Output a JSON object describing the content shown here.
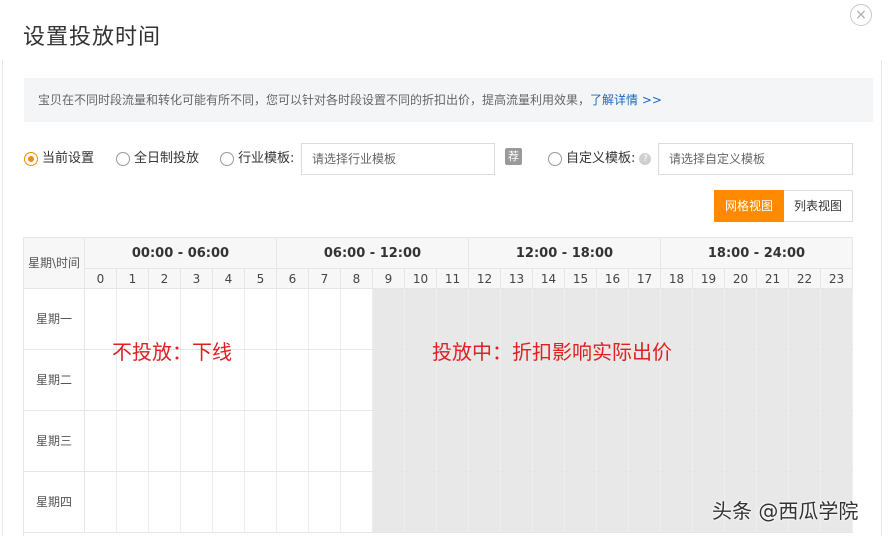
{
  "dialog": {
    "title": "设置投放时间",
    "close_symbol": "×"
  },
  "notice": {
    "text": "宝贝在不同时段流量和转化可能有所不同，您可以针对各时段设置不同的折扣出价，提高流量利用效果，",
    "link": "了解详情 >>"
  },
  "options": {
    "current": "当前设置",
    "all_day": "全日制投放",
    "industry": "行业模板:",
    "industry_placeholder": "请选择行业模板",
    "recommend_badge": "荐",
    "custom": "自定义模板:",
    "custom_placeholder": "请选择自定义模板",
    "selected": "current"
  },
  "view_toggle": {
    "grid": "网格视图",
    "list": "列表视图",
    "active": "grid"
  },
  "grid": {
    "corner": "星期\\时间",
    "ranges": [
      "00:00 - 06:00",
      "06:00 - 12:00",
      "12:00 - 18:00",
      "18:00 - 24:00"
    ],
    "hours": [
      "0",
      "1",
      "2",
      "3",
      "4",
      "5",
      "6",
      "7",
      "8",
      "9",
      "10",
      "11",
      "12",
      "13",
      "14",
      "15",
      "16",
      "17",
      "18",
      "19",
      "20",
      "21",
      "22",
      "23"
    ],
    "days": [
      "星期一",
      "星期二",
      "星期三",
      "星期四"
    ],
    "active_from_hour": 9
  },
  "annotations": {
    "off": "不投放：下线",
    "on": "投放中：折扣影响实际出价"
  },
  "watermark": "头条 @西瓜学院",
  "colors": {
    "accent": "#ff8a00",
    "link": "#1a66c2",
    "active_cell": "#e8e8e8",
    "annotation": "#e02020"
  }
}
